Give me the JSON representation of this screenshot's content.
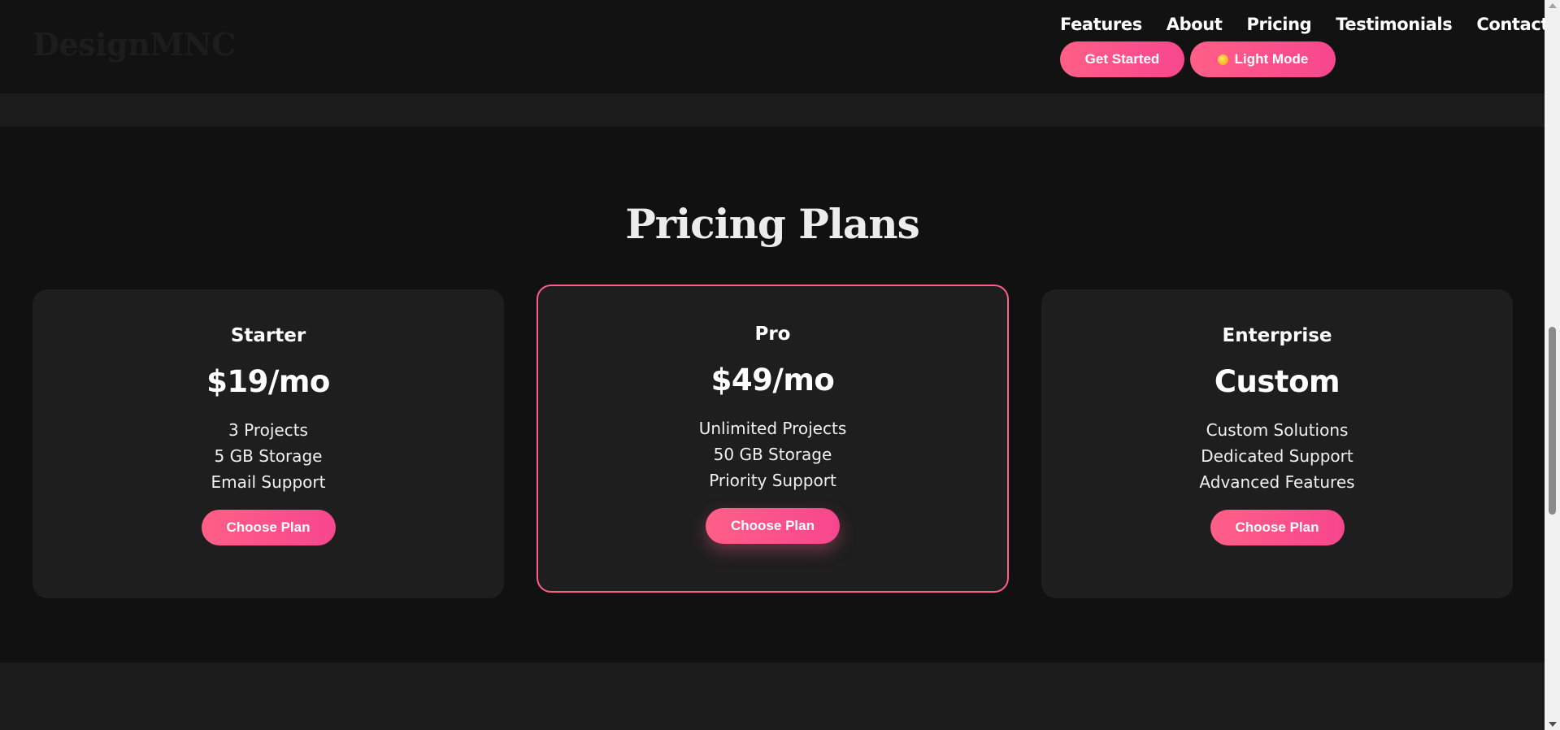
{
  "header": {
    "logo": "DesignMNC",
    "nav": {
      "features": "Features",
      "about": "About",
      "pricing": "Pricing",
      "testimonials": "Testimonials",
      "contact": "Contact"
    },
    "get_started_label": "Get Started",
    "light_mode_label": "Light Mode",
    "light_mode_icon": "sun-icon"
  },
  "pricing": {
    "title": "Pricing Plans",
    "plans": [
      {
        "name": "Starter",
        "price": "$19/mo",
        "features": [
          "3 Projects",
          "5 GB Storage",
          "Email Support"
        ],
        "button": "Choose Plan"
      },
      {
        "name": "Pro",
        "price": "$49/mo",
        "features": [
          "Unlimited Projects",
          "50 GB Storage",
          "Priority Support"
        ],
        "button": "Choose Plan",
        "highlighted": true
      },
      {
        "name": "Enterprise",
        "price": "Custom",
        "features": [
          "Custom Solutions",
          "Dedicated Support",
          "Advanced Features"
        ],
        "button": "Choose Plan"
      }
    ]
  },
  "colors": {
    "background": "#111111",
    "card": "#1e1e1f",
    "accent": "#ff5f87",
    "accent_end": "#f7468e",
    "text": "#ffffff"
  }
}
